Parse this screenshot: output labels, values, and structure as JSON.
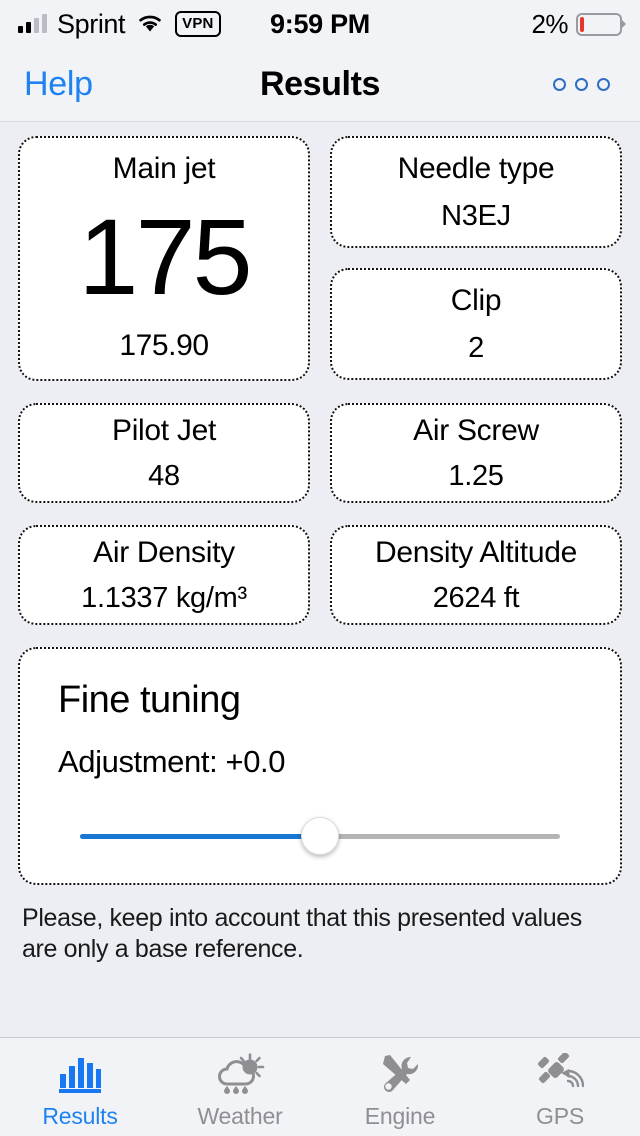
{
  "status_bar": {
    "carrier": "Sprint",
    "vpn_label": "VPN",
    "time": "9:59 PM",
    "battery_percent": "2%",
    "signal_icon": "cellular-bars-icon",
    "wifi_icon": "wifi-icon",
    "battery_icon": "battery-icon"
  },
  "nav": {
    "help_label": "Help",
    "title": "Results",
    "more_icon": "more-options-icon"
  },
  "cards": {
    "main_jet": {
      "title": "Main jet",
      "value": "175",
      "sub": "175.90"
    },
    "needle_type": {
      "title": "Needle type",
      "value": "N3EJ"
    },
    "clip": {
      "title": "Clip",
      "value": "2"
    },
    "pilot_jet": {
      "title": "Pilot Jet",
      "value": "48"
    },
    "air_screw": {
      "title": "Air Screw",
      "value": "1.25"
    },
    "air_density": {
      "title": "Air Density",
      "value": "1.1337 kg/m³"
    },
    "density_altitude": {
      "title": "Density Altitude",
      "value": "2624 ft"
    }
  },
  "fine_tuning": {
    "title": "Fine tuning",
    "adjustment_label": "Adjustment:  +0.0",
    "slider_percent": 50,
    "slider_fill_color": "#1877d2",
    "slider_track_color": "#b4b4b4"
  },
  "disclaimer": "Please, keep into account that this presented values are only a base reference.",
  "tabs": [
    {
      "label": "Results",
      "icon": "bar-chart-icon",
      "active": true
    },
    {
      "label": "Weather",
      "icon": "sun-cloud-rain-icon",
      "active": false
    },
    {
      "label": "Engine",
      "icon": "wrench-screwdriver-icon",
      "active": false
    },
    {
      "label": "GPS",
      "icon": "satellite-icon",
      "active": false
    }
  ],
  "colors": {
    "accent": "#1e82f0",
    "inactive": "#8e8e93",
    "background": "#eceef3",
    "card": "#ffffff"
  }
}
